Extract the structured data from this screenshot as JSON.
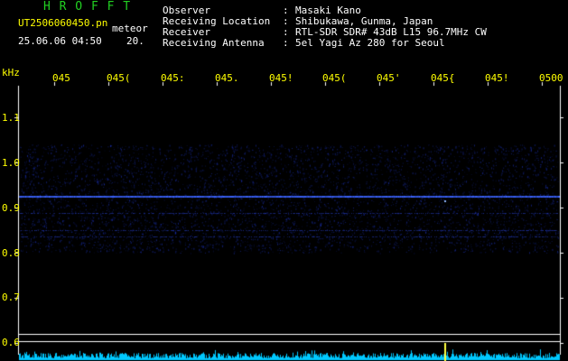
{
  "header": {
    "logo": "H R O F F T",
    "filename": "UT2506060450.pn",
    "meteor_label": "meteor",
    "datetime": "25.06.06 04:50",
    "meteor_count": "20.",
    "fields": [
      {
        "label": "Observer",
        "value": "Masaki Kano"
      },
      {
        "label": "Receiving Location",
        "value": "Shibukawa, Gunma, Japan"
      },
      {
        "label": "Receiver",
        "value": "RTL-SDR SDR# 43dB L15 96.7MHz CW"
      },
      {
        "label": "Receiving Antenna",
        "value": "5el Yagi Az 280 for Seoul"
      }
    ],
    "colon": ":"
  },
  "axis": {
    "unit": "kHz",
    "time_ticks": [
      "045",
      "045(",
      "045:",
      "045.",
      "045!",
      "045(",
      "045'",
      "045{",
      "045!",
      "0500"
    ],
    "freq_ticks": [
      "1.1",
      "1.0",
      "0.9",
      "0.8",
      "0.7",
      "0.6"
    ]
  },
  "colors": {
    "background": "#000000",
    "header_text": "#ffffff",
    "axis_text": "#ffff00",
    "logo": "#22d022",
    "signal": "#2a4dff",
    "bottom_trace": "#00c8ff"
  }
}
